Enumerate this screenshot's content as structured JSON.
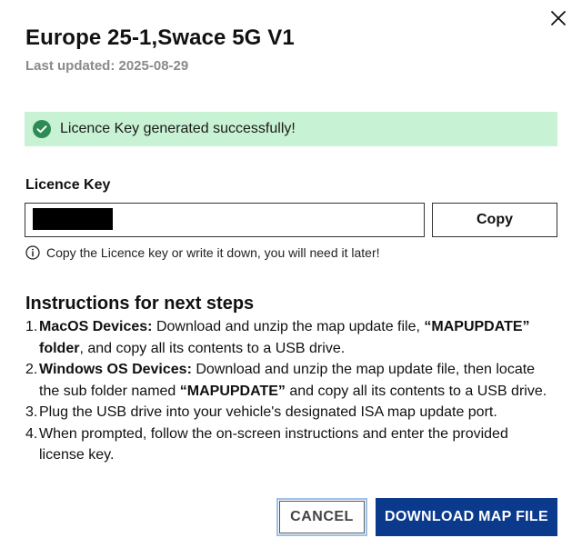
{
  "dialog": {
    "title": "Europe 25-1,Swace 5G V1",
    "subtitle": "Last updated: 2025-08-29",
    "close_icon": "close-icon"
  },
  "success": {
    "message": "Licence Key generated successfully!",
    "icon": "check-circle-icon",
    "bg_color": "#c8f2d4",
    "icon_color": "#2e8b57"
  },
  "licence": {
    "label": "Licence Key",
    "value": "",
    "copy_label": "Copy",
    "info_icon": "info-icon",
    "info_text": "Copy the Licence key or write it down, you will need it later!"
  },
  "instructions": {
    "heading": "Instructions for next steps",
    "steps": [
      {
        "number": "1.",
        "bold_prefix": "MacOS Devices:",
        "text_a": " Download and unzip the map update file, ",
        "bold_mid": "“MAPUPDATE” folder",
        "text_b": ", and copy all its contents to a USB drive."
      },
      {
        "number": "2.",
        "bold_prefix": "Windows OS Devices:",
        "text_a": " Download and unzip the map update file, then locate the sub folder named ",
        "bold_mid": "“MAPUPDATE”",
        "text_b": " and copy all its contents to a USB drive."
      },
      {
        "number": "3.",
        "text": "Plug the USB drive into your vehicle's designated ISA map update port."
      },
      {
        "number": "4.",
        "text": "When prompted, follow the on-screen instructions and enter the provided license key."
      }
    ]
  },
  "actions": {
    "cancel_label": "CANCEL",
    "download_label": "DOWNLOAD MAP FILE",
    "download_color": "#0b3a8c"
  }
}
